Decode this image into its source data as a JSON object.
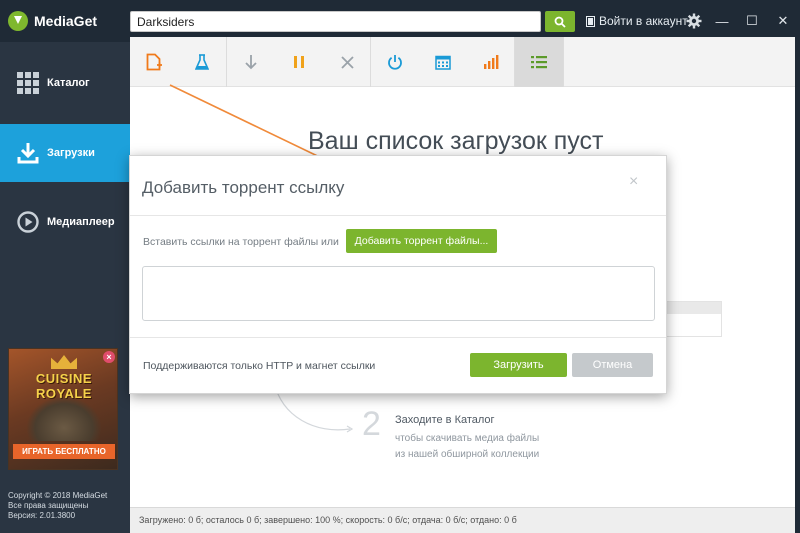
{
  "app": {
    "name": "MediaGet"
  },
  "search": {
    "value": "Darksiders"
  },
  "header": {
    "login_label": "Войти в аккаунт"
  },
  "window_controls": {
    "minimize": "—",
    "maximize": "☐",
    "close": "✕"
  },
  "sidebar": {
    "items": [
      {
        "label": "Каталог",
        "icon": "grid-icon"
      },
      {
        "label": "Загрузки",
        "icon": "download-icon",
        "active": true
      },
      {
        "label": "Медиаплеер",
        "icon": "play-icon"
      }
    ],
    "ad": {
      "title": "CUISINE ROYALE",
      "button": "ИГРАТЬ БЕСПЛАТНО",
      "close": "×"
    },
    "copyright": [
      "Copyright © 2018 MediaGet",
      "Все права защищены",
      "Версия: 2.01.3800"
    ]
  },
  "toolbar": {
    "buttons": [
      "add-file-icon",
      "flask-icon",
      "download-arrow-icon",
      "pause-icon",
      "close-icon",
      "power-icon",
      "calendar-icon",
      "bar-chart-icon",
      "list-icon"
    ]
  },
  "main": {
    "empty_title": "Ваш список загрузок пуст",
    "step": {
      "number": "2",
      "title": "Заходите в Каталог",
      "desc_line1": "чтобы скачивать медиа файлы",
      "desc_line2": "из нашей обширной коллекции"
    }
  },
  "status_bar": {
    "text": "Загружено: 0 б; осталось 0 б; завершено: 100 %; скорость: 0 б/с; отдача: 0 б/с; отдано: 0 б"
  },
  "modal": {
    "title": "Добавить торрент ссылку",
    "close": "×",
    "paste_label": "Вставить ссылки на торрент файлы или",
    "add_files_button": "Добавить торрент файлы...",
    "textarea_value": "",
    "note": "Поддерживаются только HTTP и магнет ссылки",
    "load_button": "Загрузить",
    "cancel_button": "Отмена"
  },
  "colors": {
    "accent_green": "#7cb52e",
    "sidebar_active": "#1da1db",
    "sidebar_bg": "#2a3542",
    "toolbar_orange": "#f07a1a",
    "toolbar_blue": "#1a9ad6",
    "annotation_arrow": "#f08a3a"
  }
}
